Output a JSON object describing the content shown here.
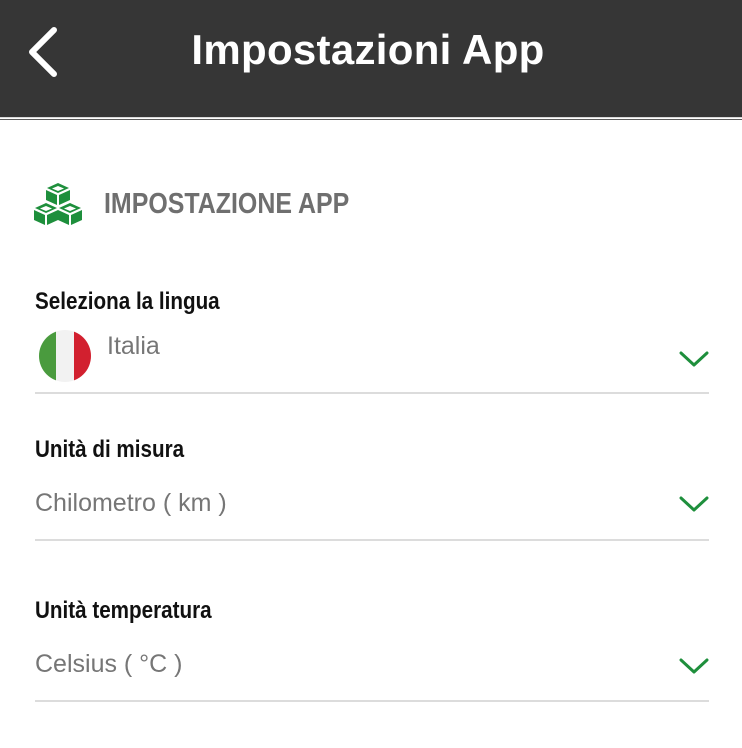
{
  "header": {
    "title": "Impostazioni App"
  },
  "section": {
    "title": "IMPOSTAZIONE APP",
    "icon": "cubes-icon",
    "accent_color": "#1e8f3c"
  },
  "fields": {
    "language": {
      "label": "Seleziona la lingua",
      "value": "Italia",
      "flag_colors": [
        "#4a9b3e",
        "#f2f2f2",
        "#d2202f"
      ]
    },
    "units": {
      "label": "Unità di misura",
      "value": "Chilometro ( km )"
    },
    "temperature": {
      "label": "Unità temperatura",
      "value": "Celsius ( °C )"
    }
  }
}
